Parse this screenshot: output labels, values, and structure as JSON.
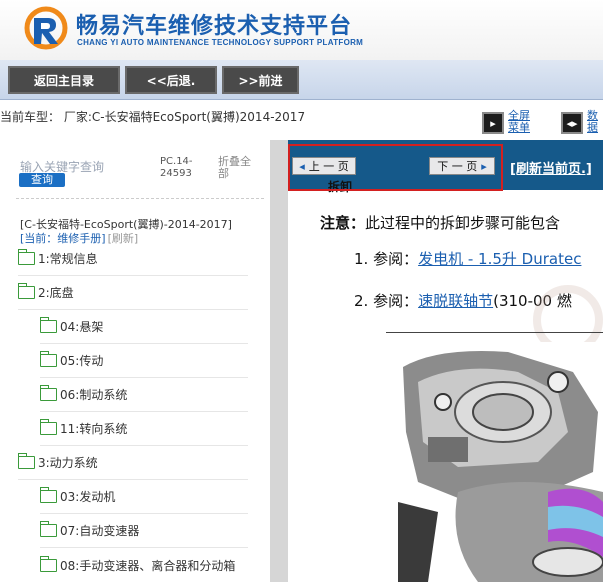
{
  "header": {
    "title": "畅易汽车维修技术支持平台",
    "subtitle": "CHANG YI AUTO MAINTENANCE TECHNOLOGY SUPPORT PLATFORM"
  },
  "nav": {
    "back_main": "返回主目录",
    "back": "<<后退.",
    "forward": ">>前进"
  },
  "info": {
    "vehicle": "当前车型： 厂家:C-长安福特EcoSport(翼搏)2014-2017",
    "fullscreen": "全屏\n菜单",
    "data": "数\n据"
  },
  "left_panel": {
    "search_placeholder": "输入关键字查询",
    "search_button": "查询",
    "pc_number": "PC.14-\n24593",
    "collapse_all": "折叠全\n部",
    "breadcrumb": "[C-长安福特-EcoSport(翼搏)-2014-2017]",
    "current": "[当前：维修手册]",
    "refresh": "[刷新]",
    "tree": [
      {
        "label": "1:常规信息",
        "level": 0
      },
      {
        "label": "2:底盘",
        "level": 0
      },
      {
        "label": "04:悬架",
        "level": 1
      },
      {
        "label": "05:传动",
        "level": 1
      },
      {
        "label": "06:制动系统",
        "level": 1
      },
      {
        "label": "11:转向系统",
        "level": 1
      },
      {
        "label": "3:动力系统",
        "level": 0
      },
      {
        "label": "03:发动机",
        "level": 1
      },
      {
        "label": "07:自动变速器",
        "level": 1
      },
      {
        "label": "08:手动变速器、离合器和分动箱",
        "level": 1
      }
    ]
  },
  "content": {
    "prev_page": "上 一 页",
    "next_page": "下 一 页",
    "refresh_page": "[刷新当前页.]",
    "section_title": "拆卸",
    "note_label": "注意：",
    "note_text": "此过程中的拆卸步骤可能包含",
    "steps": [
      {
        "num": "1. 参阅：",
        "link": "发电机 - 1.5升 Duratec",
        "rest": ""
      },
      {
        "num": "2. 参阅：",
        "link": "速脱联轴节",
        "rest": "(310-00 燃"
      }
    ]
  },
  "colors": {
    "brand_blue": "#1b5fb0",
    "content_bar": "#15598a",
    "highlight_red": "#d32020",
    "folder_green": "#3a9a3a"
  }
}
